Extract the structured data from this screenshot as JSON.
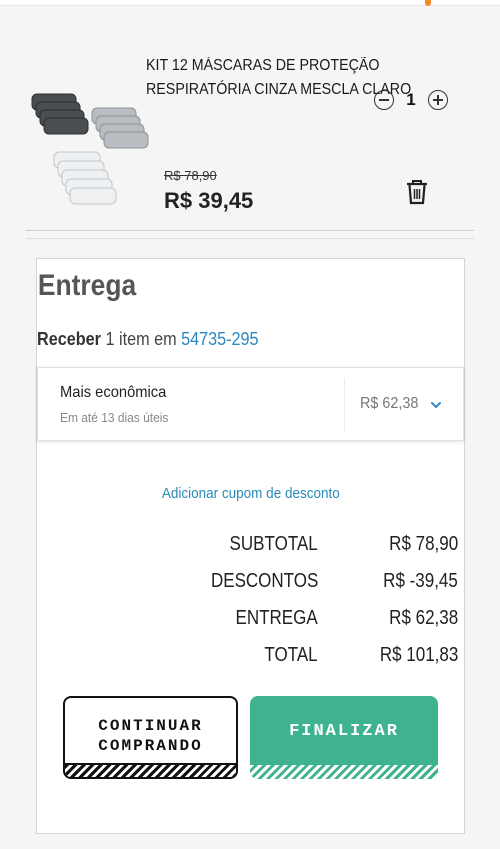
{
  "colors": {
    "accent_blue": "#2e86c1",
    "finish_green": "#3fb28f",
    "top_dot_orange": "#f28c28"
  },
  "product": {
    "title": "KIT 12 MÁSCARAS DE PROTEÇÃO RESPIRATÓRIA CINZA MESCLA CLARO",
    "quantity": "1",
    "old_price": "R$ 78,90",
    "price": "R$ 39,45",
    "icons": {
      "decrease": "minus-circle-icon",
      "increase": "plus-circle-icon",
      "remove": "trash-icon"
    }
  },
  "delivery": {
    "title": "Entrega",
    "receive_prefix": "Receber",
    "receive_middle": "1 item em",
    "cep": "54735-295",
    "option": {
      "name": "Mais econômica",
      "eta": "Em até 13 dias úteis",
      "price": "R$ 62,38",
      "icon": "chevron-down-icon"
    },
    "coupon_link": "Adicionar cupom de desconto"
  },
  "summary": [
    {
      "label": "SUBTOTAL",
      "value": "R$ 78,90"
    },
    {
      "label": "DESCONTOS",
      "value": "R$ -39,45"
    },
    {
      "label": "ENTREGA",
      "value": "R$ 62,38"
    },
    {
      "label": "TOTAL",
      "value": "R$ 101,83"
    }
  ],
  "buttons": {
    "continue_line1": "CONTINUAR",
    "continue_line2": "COMPRANDO",
    "finish": "FINALIZAR"
  }
}
